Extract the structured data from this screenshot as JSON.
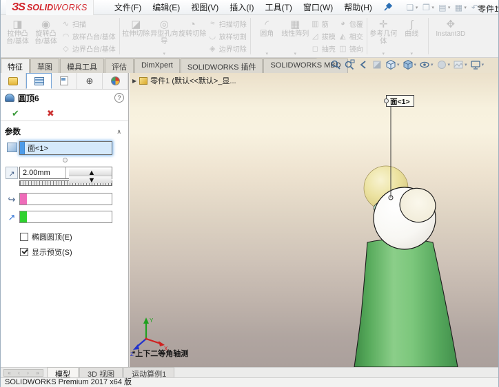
{
  "title_bar": {
    "logo": {
      "prefix": "ЗS",
      "solid": "SOLID",
      "works": "WORKS"
    },
    "menus": [
      "文件(F)",
      "编辑(E)",
      "视图(V)",
      "插入(I)",
      "工具(T)",
      "窗口(W)",
      "帮助(H)"
    ],
    "doc_title": "零件1",
    "quick_access": [
      {
        "n": "new-document-icon",
        "g": "❏",
        "c": "▾"
      },
      {
        "n": "open-document-icon",
        "g": "❐",
        "c": "▾"
      },
      {
        "n": "save-icon",
        "g": "▤",
        "c": "▾"
      },
      {
        "n": "print-icon",
        "g": "▦",
        "c": "▾"
      },
      {
        "n": "undo-icon",
        "g": "↶",
        "c": "▾"
      },
      {
        "n": "select-icon",
        "g": "▷",
        "c": "▾"
      },
      {
        "n": "attach-icon",
        "g": "✇",
        "c": ""
      },
      {
        "n": "list-icon",
        "g": "▥",
        "c": ""
      },
      {
        "n": "options-gear-icon",
        "g": "⚙",
        "c": "▾"
      },
      {
        "n": "measure-tool-icon",
        "g": "⚒",
        "c": ""
      }
    ]
  },
  "ribbon": {
    "extrude_boss": "拉伸凸台/基体",
    "revolve_boss": "旋转凸台/基体",
    "sweep": "扫描",
    "loft": "放样凸台/基体",
    "boundary": "边界凸台/基体",
    "extrude_cut": "拉伸切除",
    "hole_wizard": "异型孔向导",
    "revolve_cut": "旋转切除",
    "sweep_cut": "扫描切除",
    "loft_cut": "放样切割",
    "boundary_cut": "边界切除",
    "fillet": "圆角",
    "pattern": "线性阵列",
    "rib": "筋",
    "draft": "拔模",
    "shell": "抽壳",
    "wrap": "包覆",
    "intersect": "相交",
    "mirror": "镜向",
    "ref_geo": "参考几何体",
    "curves": "曲线",
    "instant3d": "Instant3D",
    "glyphs": {
      "extrude_boss": "◨",
      "revolve_boss": "◉",
      "sweep": "∿",
      "loft": "◠",
      "boundary": "◇",
      "extrude_cut": "◪",
      "hole_wizard": "◎",
      "revolve_cut": "◔",
      "sweep_cut": "≈",
      "loft_cut": "◡",
      "boundary_cut": "◈",
      "fillet": "◜",
      "pattern": "▦",
      "rib": "▥",
      "draft": "◿",
      "shell": "◻",
      "wrap": "◕",
      "intersect": "◭",
      "mirror": "◫",
      "ref_geo": "✛",
      "curves": "∫",
      "instant3d": "✥"
    }
  },
  "command_tabs": {
    "items": [
      "特征",
      "草图",
      "模具工具",
      "评估",
      "DimXpert",
      "SOLIDWORKS 插件",
      "SOLIDWORKS MBD"
    ],
    "active": "特征"
  },
  "heads_up_icon_names": [
    "zoom-to-fit-icon",
    "zoom-to-area-icon",
    "previous-view-icon",
    "section-view-icon",
    "view-orientation-icon",
    "display-style-icon",
    "hide-show-items-icon",
    "edit-appearance-icon",
    "apply-scene-icon",
    "view-settings-icon"
  ],
  "icons": {
    "caret": "▾",
    "collapse": "∧",
    "dimxpert": "⊕",
    "up": "▲",
    "down": "▼",
    "expand": "▶"
  },
  "feature_panel": {
    "title": "圆顶6",
    "help": "?",
    "ok": "✔",
    "cancel": "✖",
    "params": {
      "header": "参数",
      "face_value": "面<1>",
      "distance_value": "2.00mm",
      "distance_icon_glyph": "↗",
      "constraint_icon_glyph": "↪",
      "direction_icon_glyph": "↗",
      "pink_swatch": "#ee6cb9",
      "green_swatch": "#2fd12f",
      "checkboxes": [
        {
          "label": "椭圆圆顶(E)",
          "checked": false
        },
        {
          "label": "显示预览(S)",
          "checked": true
        }
      ]
    }
  },
  "viewport": {
    "tree_label": "零件1 (默认<<默认>_显...",
    "callout_label": "面<1>",
    "view_label": "*上下二等角轴测",
    "triad": {
      "x": "X",
      "y": "Y",
      "z": "Z"
    }
  },
  "bottom_bar": {
    "tabs": [
      "模型",
      "3D 视图",
      "运动算例1"
    ],
    "active": "模型",
    "nav": [
      "«",
      "‹",
      "›",
      "»"
    ]
  },
  "status_bar": {
    "text": "SOLIDWORKS Premium 2017 x64 版"
  }
}
